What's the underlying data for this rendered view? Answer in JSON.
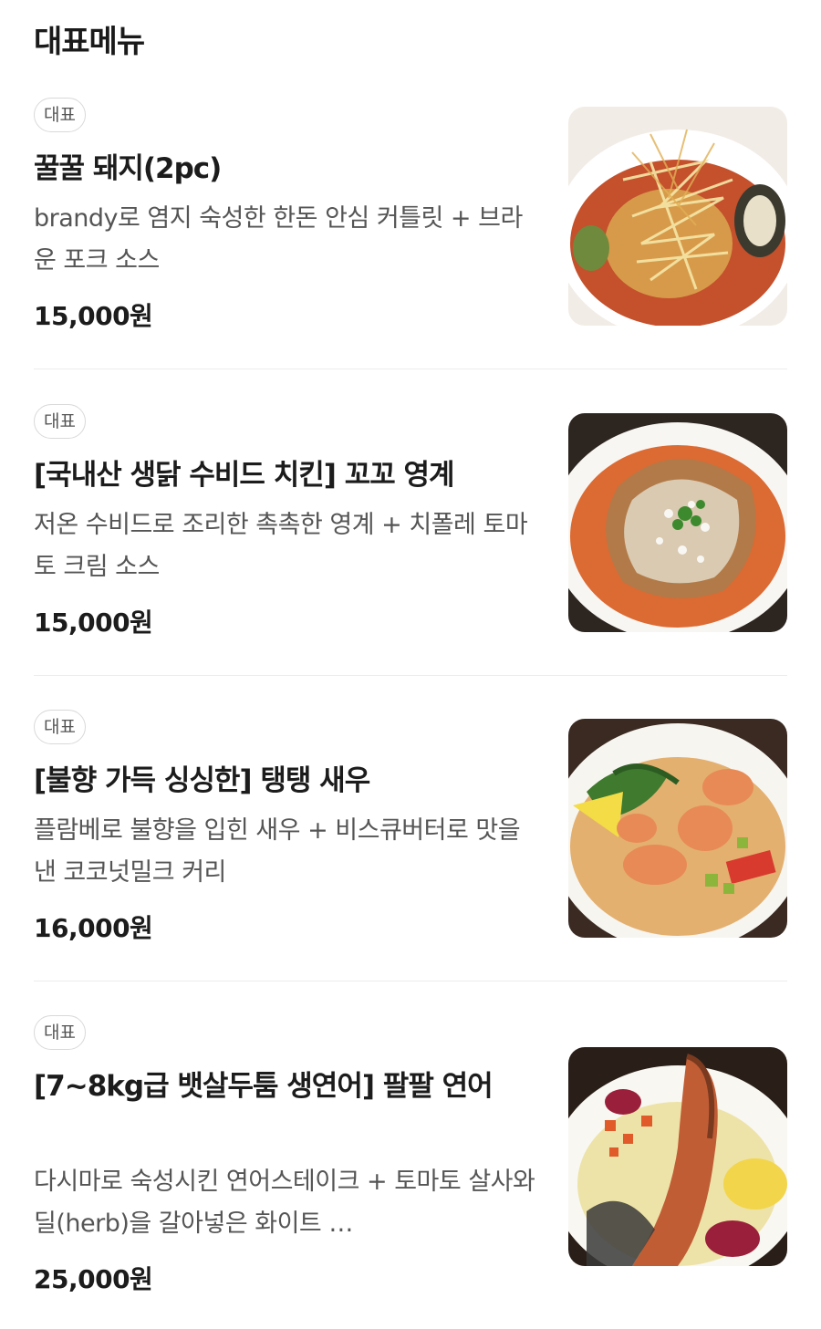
{
  "section": {
    "title": "대표메뉴"
  },
  "items": [
    {
      "badge": "대표",
      "name": "꿀꿀 돼지(2pc)",
      "description": "brandy로 염지 숙성한 한돈 안심 커틀릿 + 브라운 포크 소스",
      "price": "15,000원",
      "image_icon": "food-photo-pork-cutlet-icon"
    },
    {
      "badge": "대표",
      "name": "[국내산 생닭 수비드 치킨] 꼬꼬 영계",
      "description": "저온 수비드로 조리한 촉촉한 영계 + 치폴레 토마토 크림 소스",
      "price": "15,000원",
      "image_icon": "food-photo-chicken-icon"
    },
    {
      "badge": "대표",
      "name": "[불향 가득 싱싱한] 탱탱 새우",
      "description": "플람베로 불향을 입힌 새우 + 비스큐버터로 맛을 낸 코코넛밀크 커리",
      "price": "16,000원",
      "image_icon": "food-photo-shrimp-curry-icon"
    },
    {
      "badge": "대표",
      "name": "[7~8kg급 뱃살두툼 생연어] 팔팔 연어",
      "description": "다시마로 숙성시킨 연어스테이크 + 토마토 살사와 딜(herb)을 갈아넣은 화이트 …",
      "price": "25,000원",
      "image_icon": "food-photo-salmon-icon"
    }
  ]
}
